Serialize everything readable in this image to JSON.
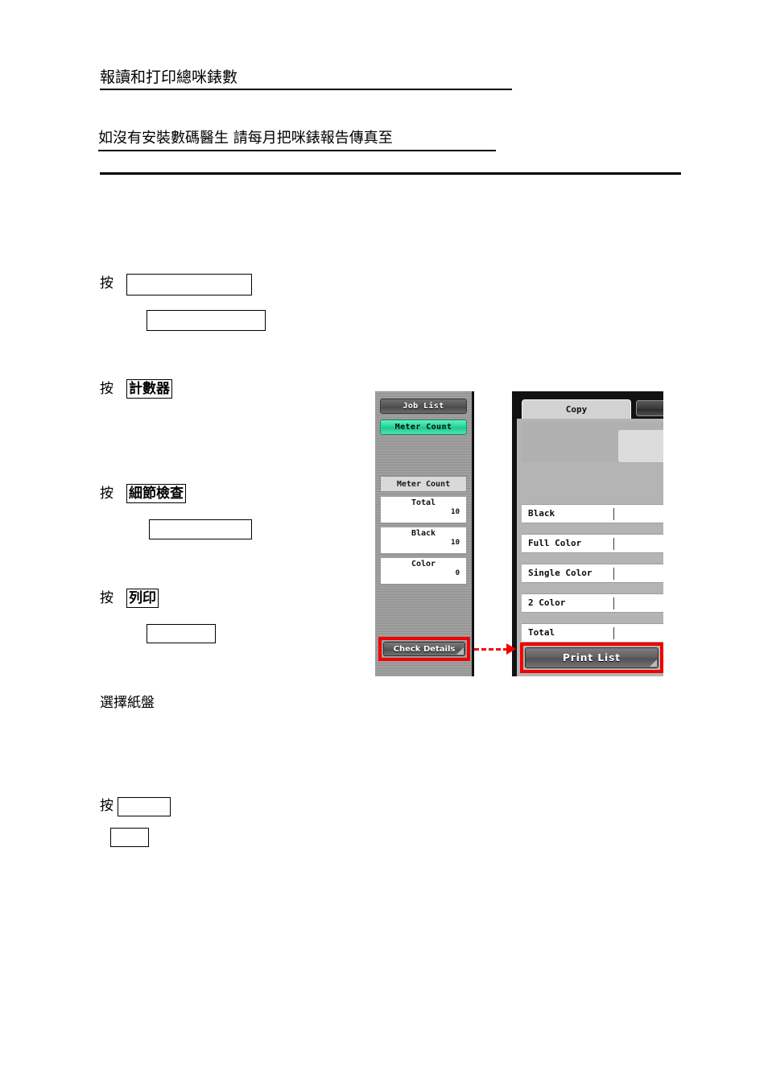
{
  "document": {
    "title": "報讀和打印總咪錶數",
    "subtitle": "如沒有安裝數碼醫生 請每月把咪錶報告傳真至",
    "steps": [
      {
        "prefix": "按",
        "key": ""
      },
      {
        "prefix": "按",
        "key": "計數器"
      },
      {
        "prefix": "按",
        "key": "細節檢查"
      },
      {
        "prefix": "按",
        "key": "列印"
      },
      {
        "prefix": "選擇紙盤",
        "key": ""
      },
      {
        "prefix": "按",
        "key": ""
      }
    ],
    "select_tray_text": "選擇紙盤"
  },
  "left_panel": {
    "buttons": [
      {
        "label": "Job List",
        "state": "normal"
      },
      {
        "label": "Meter Count",
        "state": "selected"
      }
    ],
    "section_header": "Meter Count",
    "fields": [
      {
        "name": "Total",
        "value": "10"
      },
      {
        "name": "Black",
        "value": "10"
      },
      {
        "name": "Color",
        "value": "0"
      }
    ],
    "action_button": "Check Details"
  },
  "right_panel": {
    "tabs": [
      {
        "label": "Copy",
        "active": true
      },
      {
        "label": "",
        "active": false
      }
    ],
    "rows": [
      {
        "name": "Black",
        "value": ""
      },
      {
        "name": "Full Color",
        "value": ""
      },
      {
        "name": "Single Color",
        "value": ""
      },
      {
        "name": "2 Color",
        "value": ""
      },
      {
        "name": "Total",
        "value": ""
      }
    ],
    "action_button": "Print List"
  },
  "annotations": {
    "highlight_color": "#f40000",
    "connector": "arrow-right-dashed"
  },
  "colors": {
    "selected_button": "#2ad79e",
    "highlight": "#f40000",
    "panel_background": "#b4b4b4"
  }
}
